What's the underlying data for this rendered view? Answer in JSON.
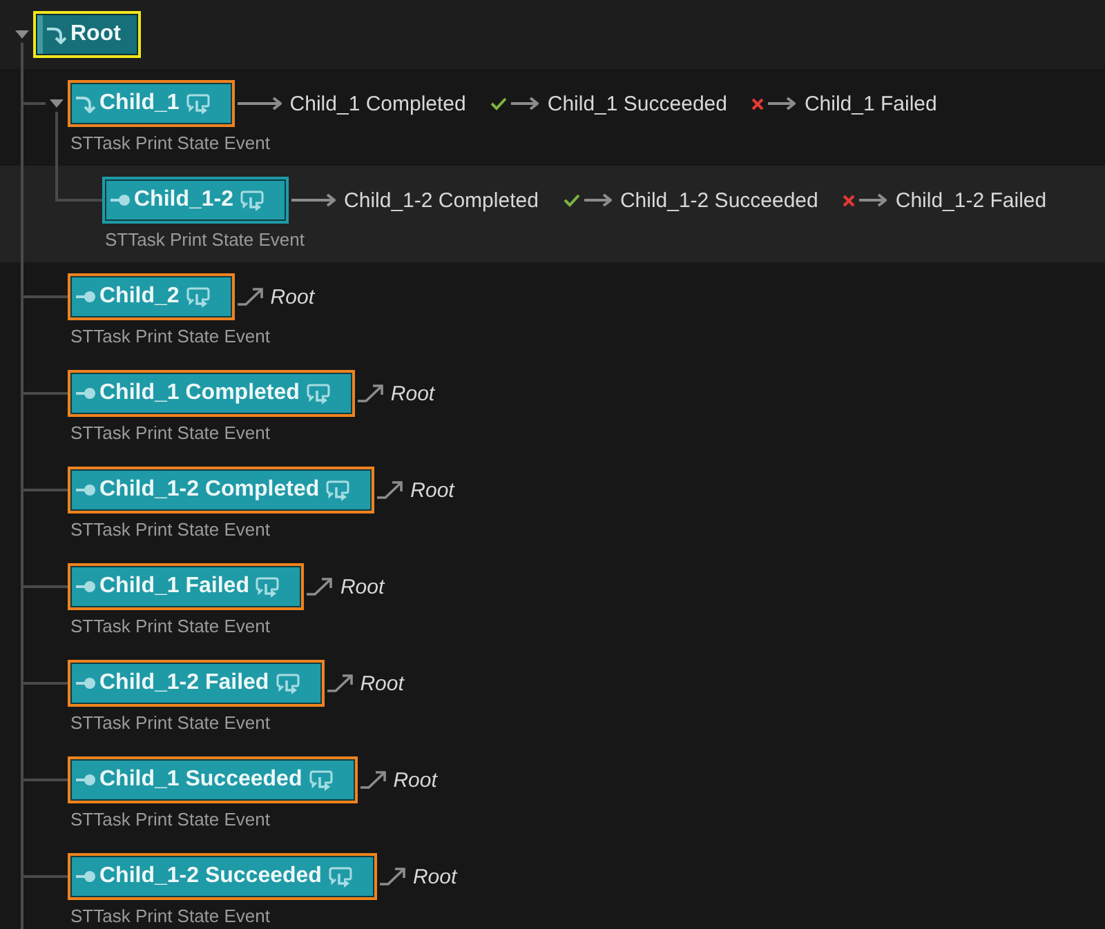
{
  "states": [
    {
      "name": "Root",
      "kind": "branch",
      "selected": false,
      "active": true,
      "expanded": true,
      "children": [
        {
          "name": "Child_1",
          "kind": "branch",
          "selected": true,
          "active": false,
          "expanded": true,
          "task": "STTask Print State Event",
          "transitions": [
            {
              "kind": "completed",
              "to_parent": false,
              "target": "Child_1 Completed"
            },
            {
              "kind": "succeeded",
              "to_parent": false,
              "target": "Child_1 Succeeded"
            },
            {
              "kind": "failed",
              "to_parent": false,
              "target": "Child_1 Failed"
            }
          ],
          "children": [
            {
              "name": "Child_1-2",
              "kind": "leaf",
              "selected": false,
              "active": false,
              "task": "STTask Print State Event",
              "transitions": [
                {
                  "kind": "completed",
                  "to_parent": false,
                  "target": "Child_1-2 Completed"
                },
                {
                  "kind": "succeeded",
                  "to_parent": false,
                  "target": "Child_1-2 Succeeded"
                },
                {
                  "kind": "failed",
                  "to_parent": false,
                  "target": "Child_1-2 Failed"
                }
              ]
            }
          ]
        },
        {
          "name": "Child_2",
          "kind": "leaf",
          "selected": true,
          "active": false,
          "task": "STTask Print State Event",
          "transitions": [
            {
              "kind": "completed",
              "to_parent": true,
              "target": "Root"
            }
          ]
        },
        {
          "name": "Child_1 Completed",
          "kind": "leaf",
          "selected": true,
          "active": false,
          "task": "STTask Print State Event",
          "transitions": [
            {
              "kind": "completed",
              "to_parent": true,
              "target": "Root"
            }
          ]
        },
        {
          "name": "Child_1-2 Completed",
          "kind": "leaf",
          "selected": true,
          "active": false,
          "task": "STTask Print State Event",
          "transitions": [
            {
              "kind": "completed",
              "to_parent": true,
              "target": "Root"
            }
          ]
        },
        {
          "name": "Child_1 Failed",
          "kind": "leaf",
          "selected": true,
          "active": false,
          "task": "STTask Print State Event",
          "transitions": [
            {
              "kind": "completed",
              "to_parent": true,
              "target": "Root"
            }
          ]
        },
        {
          "name": "Child_1-2 Failed",
          "kind": "leaf",
          "selected": true,
          "active": false,
          "task": "STTask Print State Event",
          "transitions": [
            {
              "kind": "completed",
              "to_parent": true,
              "target": "Root"
            }
          ]
        },
        {
          "name": "Child_1 Succeeded",
          "kind": "leaf",
          "selected": true,
          "active": false,
          "task": "STTask Print State Event",
          "transitions": [
            {
              "kind": "completed",
              "to_parent": true,
              "target": "Root"
            }
          ]
        },
        {
          "name": "Child_1-2 Succeeded",
          "kind": "leaf",
          "selected": true,
          "active": false,
          "task": "STTask Print State Event",
          "transitions": [
            {
              "kind": "completed",
              "to_parent": true,
              "target": "Root"
            }
          ]
        }
      ]
    }
  ]
}
